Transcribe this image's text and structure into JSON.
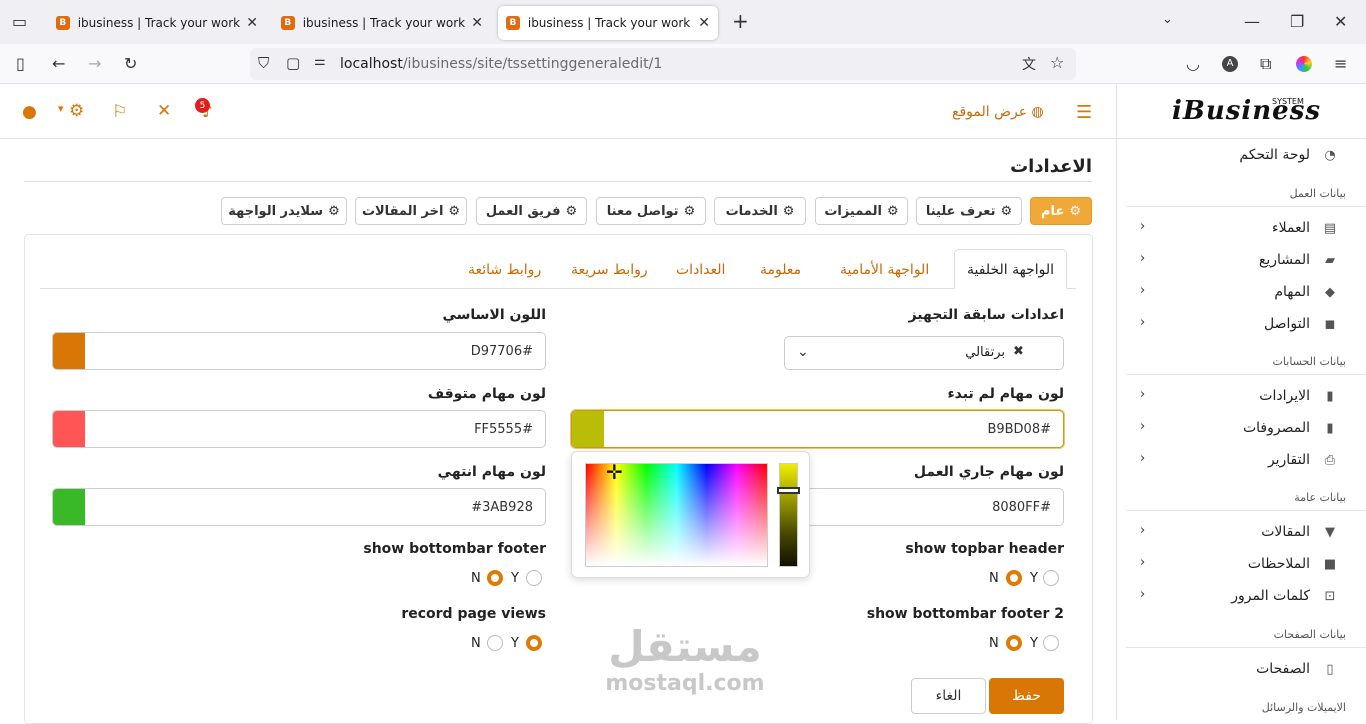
{
  "browser": {
    "tabs": [
      {
        "title": "ibusiness | Track your work with"
      },
      {
        "title": "ibusiness | Track your work with"
      },
      {
        "title": "ibusiness | Track your work with"
      }
    ],
    "url_host": "localhost",
    "url_path": "/ibusiness/site/tssettinggeneraledit/1",
    "profile_initial": "A"
  },
  "header": {
    "logo_text": "iBusiness",
    "logo_sub": "SYSTEM",
    "view_site": "عرض الموقع",
    "notification_count": "5"
  },
  "sidebar": {
    "dashboard": "لوحة التحكم",
    "sections": [
      {
        "title": "بيانات العمل"
      },
      {
        "title": "بيانات الحسابات"
      },
      {
        "title": "بيانات عامة"
      },
      {
        "title": "بيانات الصفحات"
      },
      {
        "title": "الايميلات والرسائل"
      }
    ],
    "items": [
      {
        "label": "العملاء",
        "icon": "contact-card-icon"
      },
      {
        "label": "المشاريع",
        "icon": "folder-icon"
      },
      {
        "label": "المهام",
        "icon": "tags-icon"
      },
      {
        "label": "التواصل",
        "icon": "comments-icon"
      },
      {
        "label": "الايرادات",
        "icon": "book-icon"
      },
      {
        "label": "المصروفات",
        "icon": "book-icon"
      },
      {
        "label": "التقارير",
        "icon": "print-icon"
      },
      {
        "label": "المقالات",
        "icon": "bookmark-icon"
      },
      {
        "label": "الملاحظات",
        "icon": "note-icon"
      },
      {
        "label": "كلمات المرور",
        "icon": "unlock-icon"
      },
      {
        "label": "الصفحات",
        "icon": "file-icon"
      }
    ]
  },
  "page": {
    "title": "الاعدادات",
    "section_buttons": [
      "عام",
      "تعرف علينا",
      "المميزات",
      "الخدمات",
      "تواصل معنا",
      "فريق العمل",
      "اخر المقالات",
      "سلايدر الواجهة"
    ],
    "tabs": [
      "الواجهة الخلفية",
      "الواجهة الأمامية",
      "معلومة",
      "العدادات",
      "روابط سريعة",
      "روابط شائعة"
    ],
    "preset_label": "اعدادات سابقة التجهيز",
    "preset_value": "برتقالي",
    "primary_color_label": "اللون الاساسي",
    "primary_color": "D97706#",
    "not_started_label": "لون مهام لم تبدء",
    "not_started_color": "B9BD08#",
    "stopped_label": "لون مهام متوقف",
    "stopped_color": "FF5555#",
    "in_progress_label": "لون مهام جاري العمل",
    "in_progress_color": "8080FF#",
    "finished_label": "لون مهام انتهي",
    "finished_color": "#3AB928",
    "show_topbar_label": "show topbar header",
    "show_bottombar_label": "show bottombar footer",
    "show_bottombar2_label": "show bottombar footer 2",
    "record_views_label": "record page views",
    "radio_n": "N",
    "radio_y": "Y",
    "save": "حفظ",
    "cancel": "الغاء"
  },
  "colors": {
    "accent": "#d97706",
    "primary_swatch": "#D97706",
    "not_started_swatch": "#B9BD08",
    "stopped_swatch": "#FF5555",
    "in_progress_swatch": "#8080FF",
    "finished_swatch": "#3AB928"
  },
  "watermark": {
    "arabic": "مستقل",
    "latin": "mostaql.com"
  }
}
